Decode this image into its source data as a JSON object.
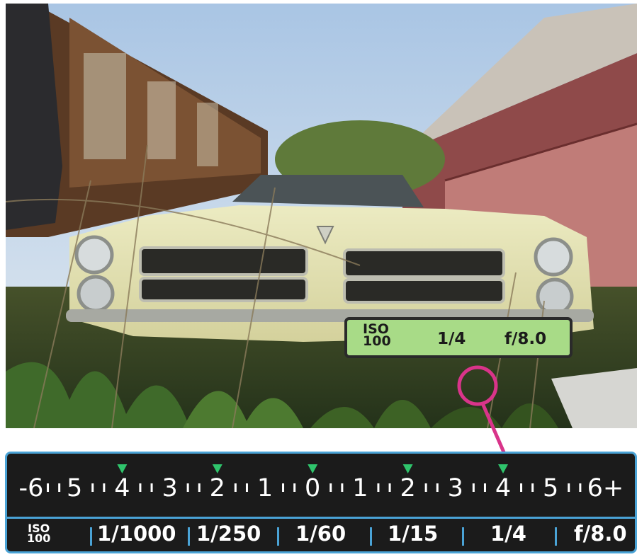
{
  "photo": {
    "subject": "abandoned Pontiac car in overgrown weeds",
    "grille_badge": "PONTIAC"
  },
  "readout": {
    "iso_label": "ISO",
    "iso_value": "100",
    "shutter": "1/4",
    "aperture": "f/8.0"
  },
  "scale": {
    "tick_labels": [
      "-6",
      "5",
      "4",
      "3",
      "2",
      "1",
      "0",
      "1",
      "2",
      "3",
      "4",
      "5",
      "6+"
    ],
    "marker_positions": [
      "4",
      "2",
      "0",
      "2",
      "4"
    ],
    "highlighted_marker": "4",
    "iso_label": "ISO",
    "iso_value": "100",
    "shutter_values": [
      "1/1000",
      "1/250",
      "1/60",
      "1/15",
      "1/4"
    ],
    "aperture": "f/8.0"
  },
  "colors": {
    "accent_blue": "#4aa3d6",
    "readout_green": "#a8db87",
    "marker_green": "#2fc46c",
    "callout_pink": "#d9348a"
  }
}
